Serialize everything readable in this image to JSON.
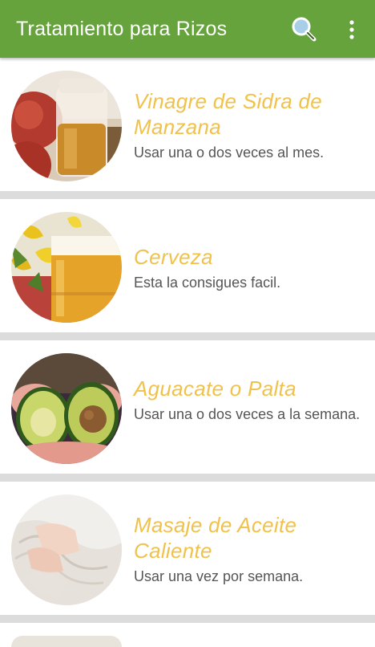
{
  "appbar": {
    "title": "Tratamiento para Rizos",
    "search_icon": "magnifier-icon",
    "more_icon": "more-vert-icon",
    "background": "#66a33d"
  },
  "remedies": [
    {
      "title": "Vinagre de Sidra de Manzana",
      "subtitle": "Usar una o dos veces al mes.",
      "image": "apple-cider-vinegar-jar-and-apples"
    },
    {
      "title": "Cerveza",
      "subtitle": "Esta la consigues facil.",
      "image": "beer-glass-with-yellow-flowers"
    },
    {
      "title": "Aguacate o Palta",
      "subtitle": "Usar una o dos veces a la semana.",
      "image": "avocado-halves-in-hands"
    },
    {
      "title": "Masaje de Aceite Caliente",
      "subtitle": "Usar una vez por semana.",
      "image": "hand-massaging-hair"
    }
  ],
  "colors": {
    "title_yellow": "#f0c24b",
    "subtitle_gray": "#555555",
    "divider": "#dcdcdc"
  }
}
